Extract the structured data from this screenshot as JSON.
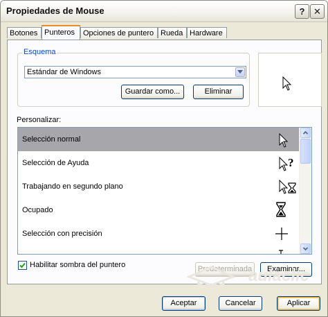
{
  "window": {
    "title": "Propiedades de Mouse",
    "help_glyph": "?",
    "close_glyph": "✕"
  },
  "tabs": [
    {
      "label": "Botones",
      "active": false
    },
    {
      "label": "Punteros",
      "active": true
    },
    {
      "label": "Opciones de puntero",
      "active": false
    },
    {
      "label": "Rueda",
      "active": false
    },
    {
      "label": "Hardware",
      "active": false
    }
  ],
  "scheme": {
    "group_label": "Esquema",
    "selected": "Estándar de Windows",
    "save_as_label": "Guardar como...",
    "delete_label": "Eliminar"
  },
  "customize": {
    "label": "Personalizar:",
    "items": [
      {
        "label": "Selección normal",
        "icon": "arrow-cursor-icon",
        "selected": true
      },
      {
        "label": "Selección de Ayuda",
        "icon": "help-select-cursor-icon",
        "selected": false
      },
      {
        "label": "Trabajando en segundo plano",
        "icon": "working-in-background-cursor-icon",
        "selected": false
      },
      {
        "label": "Ocupado",
        "icon": "hourglass-cursor-icon",
        "selected": false
      },
      {
        "label": "Selección con precisión",
        "icon": "crosshair-cursor-icon",
        "selected": false
      }
    ]
  },
  "shadow": {
    "label": "Habilitar sombra del puntero",
    "checked": true
  },
  "pointer_buttons": {
    "default_label": "Predeterminada",
    "browse_label": "Examinar..."
  },
  "watermark": {
    "text": "aulaclic"
  },
  "footer": {
    "ok_label": "Aceptar",
    "cancel_label": "Cancelar",
    "apply_label": "Aplicar"
  }
}
